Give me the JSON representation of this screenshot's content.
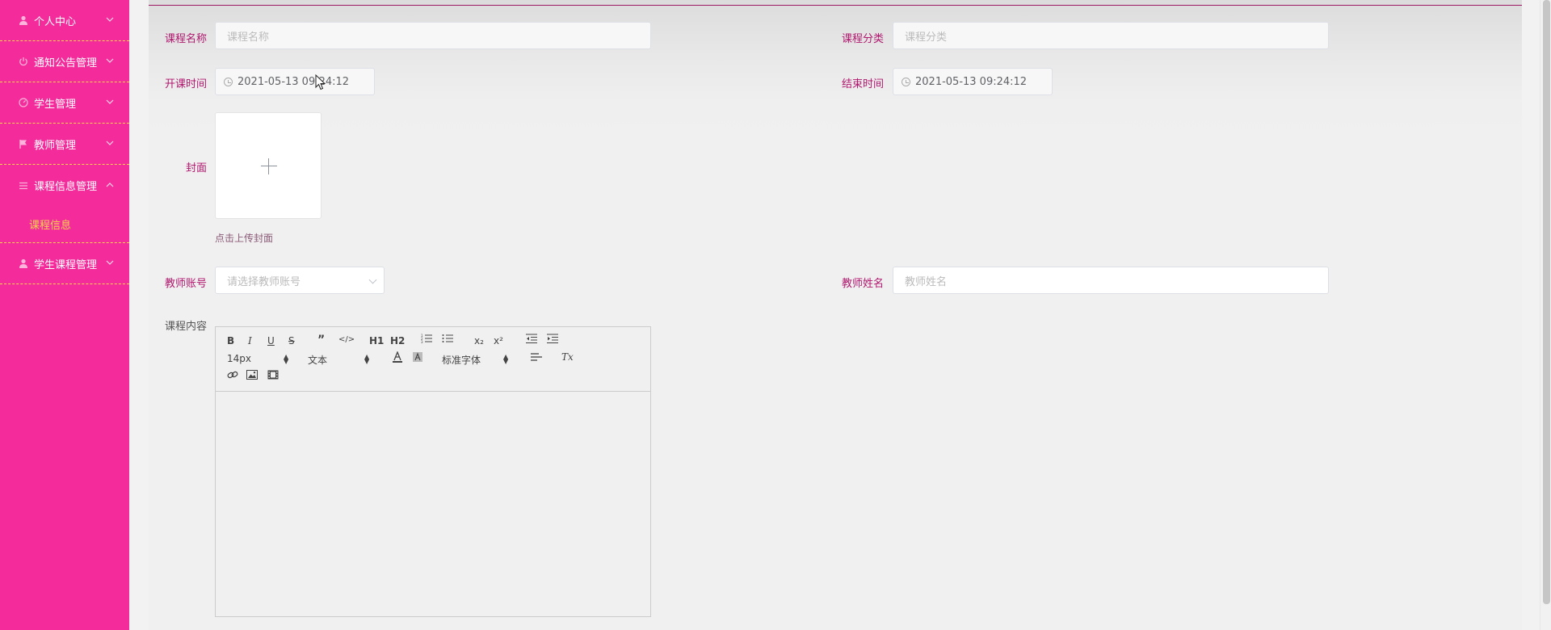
{
  "colors": {
    "sidebar_bg": "#f42c9b",
    "accent_yellow": "#f7d24c",
    "label": "#b0176e"
  },
  "sidebar": {
    "items": [
      {
        "label": "个人中心",
        "icon": "user-icon",
        "expanded": false
      },
      {
        "label": "通知公告管理",
        "icon": "power-icon",
        "expanded": false
      },
      {
        "label": "学生管理",
        "icon": "gauge-icon",
        "expanded": false
      },
      {
        "label": "教师管理",
        "icon": "flag-icon",
        "expanded": false
      },
      {
        "label": "课程信息管理",
        "icon": "list-icon",
        "expanded": true,
        "children": [
          {
            "label": "课程信息",
            "active": true
          }
        ]
      },
      {
        "label": "学生课程管理",
        "icon": "user-icon",
        "expanded": false
      }
    ]
  },
  "form": {
    "course_name": {
      "label": "课程名称",
      "placeholder": "课程名称"
    },
    "course_category": {
      "label": "课程分类",
      "placeholder": "课程分类"
    },
    "start_time": {
      "label": "开课时间",
      "value": "2021-05-13 09:24:12"
    },
    "end_time": {
      "label": "结束时间",
      "value": "2021-05-13 09:24:12"
    },
    "cover": {
      "label": "封面",
      "hint": "点击上传封面"
    },
    "teacher_account": {
      "label": "教师账号",
      "placeholder": "请选择教师账号"
    },
    "teacher_name": {
      "label": "教师姓名",
      "placeholder": "教师姓名"
    },
    "course_content": {
      "label": "课程内容",
      "toolbar": {
        "h1": "H1",
        "h2": "H2",
        "font_size": "14px",
        "header": "文本",
        "font_family": "标准字体",
        "sub": "x₂",
        "sup": "x²",
        "clean": "Tx"
      }
    }
  }
}
